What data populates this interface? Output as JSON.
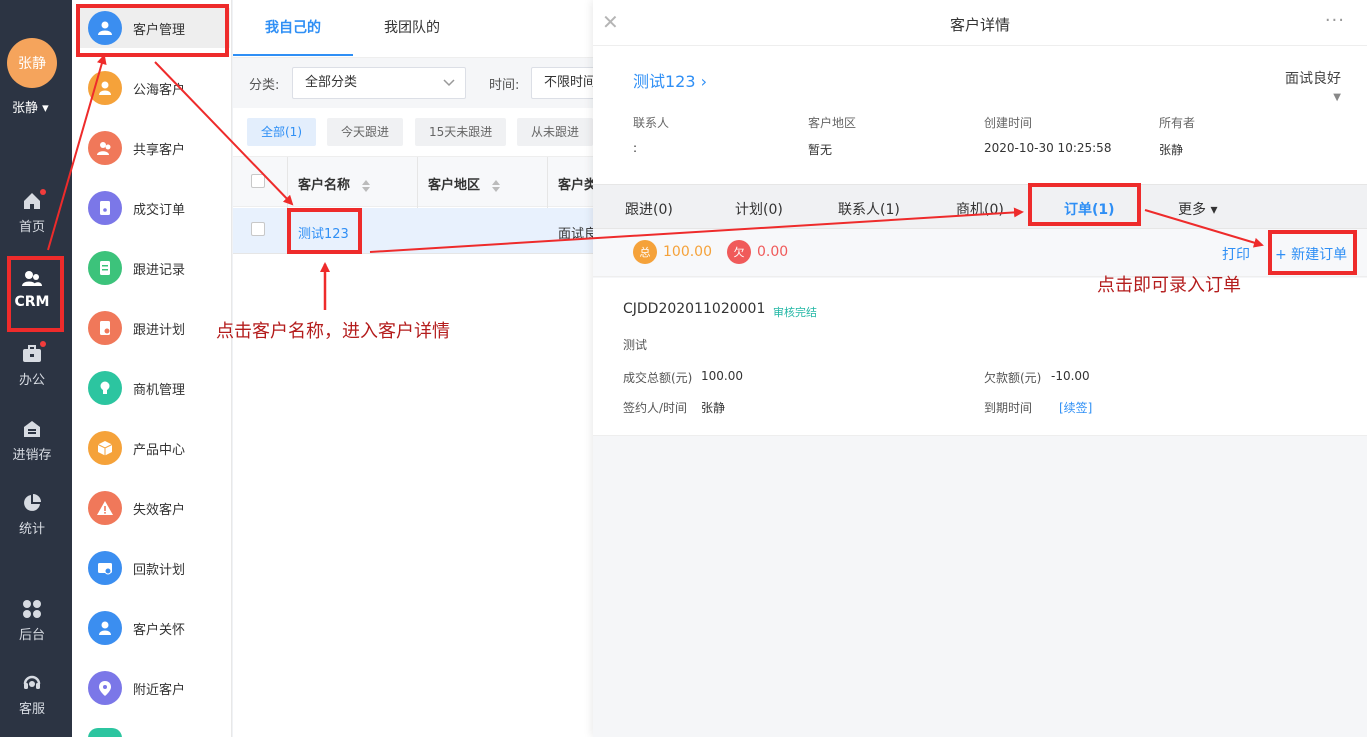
{
  "user": {
    "avatar_text": "张静",
    "name": "张静 ▾"
  },
  "nav": {
    "items": [
      {
        "label": "首页"
      },
      {
        "label": "CRM"
      },
      {
        "label": "办公"
      },
      {
        "label": "进销存"
      },
      {
        "label": "统计"
      },
      {
        "label": "后台"
      },
      {
        "label": "客服"
      }
    ]
  },
  "submenu": {
    "items": [
      {
        "label": "客户管理",
        "color": "#3b8ef0"
      },
      {
        "label": "公海客户",
        "color": "#f5a23a"
      },
      {
        "label": "共享客户",
        "color": "#f0785a"
      },
      {
        "label": "成交订单",
        "color": "#7b77e8"
      },
      {
        "label": "跟进记录",
        "color": "#3cc37b"
      },
      {
        "label": "跟进计划",
        "color": "#f0785a"
      },
      {
        "label": "商机管理",
        "color": "#2cc5a0"
      },
      {
        "label": "产品中心",
        "color": "#f5a23a"
      },
      {
        "label": "失效客户",
        "color": "#f0785a"
      },
      {
        "label": "回款计划",
        "color": "#3b8ef0"
      },
      {
        "label": "客户关怀",
        "color": "#3b8ef0"
      },
      {
        "label": "附近客户",
        "color": "#7b77e8"
      }
    ]
  },
  "main": {
    "tabs": [
      {
        "label": "我自己的"
      },
      {
        "label": "我团队的"
      }
    ],
    "filter": {
      "category_label": "分类:",
      "category_value": "全部分类",
      "time_label": "时间:",
      "time_value": "不限时间"
    },
    "quick_filters": [
      {
        "label": "全部(1)"
      },
      {
        "label": "今天跟进"
      },
      {
        "label": "15天未跟进"
      },
      {
        "label": "从未跟进"
      }
    ],
    "table": {
      "columns": [
        "客户名称",
        "客户地区",
        "客户类"
      ],
      "rows": [
        {
          "name": "测试123",
          "region": "",
          "type": "面试良"
        }
      ]
    }
  },
  "detail": {
    "title": "客户详情",
    "customer_name": "测试123 ›",
    "stage": "面试良好",
    "info": [
      {
        "label": "联系人",
        "value": ":"
      },
      {
        "label": "客户地区",
        "value": "暂无"
      },
      {
        "label": "创建时间",
        "value": "2020-10-30 10:25:58"
      },
      {
        "label": "所有者",
        "value": "张静"
      }
    ],
    "tabs": [
      {
        "label": "跟进(0)"
      },
      {
        "label": "计划(0)"
      },
      {
        "label": "联系人(1)"
      },
      {
        "label": "商机(0)"
      },
      {
        "label": "订单(1)"
      },
      {
        "label": "更多 ▾"
      }
    ],
    "summary": {
      "total_icon": "总",
      "total_value": "100.00",
      "owe_icon": "欠",
      "owe_value": "0.00",
      "print_label": "打印",
      "new_order_label": "+ 新建订单"
    },
    "order": {
      "id": "CJDD202011020001",
      "status": "审核完结",
      "title": "测试",
      "amount_label": "成交总额(元)",
      "amount_value": "100.00",
      "owed_label": "欠款额(元)",
      "owed_value": "-10.00",
      "signer_label": "签约人/时间",
      "signer_value": "张静",
      "expire_label": "到期时间",
      "renew_label": "[续签]"
    }
  },
  "annotations": {
    "note_click_name": "点击客户名称，进入客户详情",
    "note_new_order": "点击即可录入订单"
  },
  "colors": {
    "accent": "#2f8ff5",
    "annotation": "#ee2b2b",
    "nav_bg": "#2c3443"
  }
}
